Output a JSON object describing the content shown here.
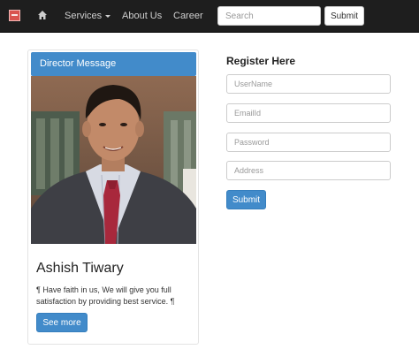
{
  "navbar": {
    "brand_icon": "brand-logo-icon",
    "home_icon": "home-icon",
    "links": [
      {
        "label": "Services",
        "has_dropdown": true
      },
      {
        "label": "About Us"
      },
      {
        "label": "Career"
      }
    ],
    "search_placeholder": "Search",
    "submit_label": "Submit"
  },
  "director_card": {
    "heading": "Director Message",
    "photo": "portrait-photo",
    "name": "Ashish Tiwary",
    "message": "¶ Have faith in us, We will give you full satisfaction by providing best service. ¶",
    "button_label": "See more"
  },
  "register": {
    "title": "Register Here",
    "fields": [
      {
        "placeholder": "UserName"
      },
      {
        "placeholder": "EmailId"
      },
      {
        "placeholder": "Password"
      },
      {
        "placeholder": "Address"
      }
    ],
    "submit_label": "Submit"
  },
  "colors": {
    "navbar_bg": "#1e1e1e",
    "primary": "#428bca",
    "brand": "#d9534f"
  }
}
